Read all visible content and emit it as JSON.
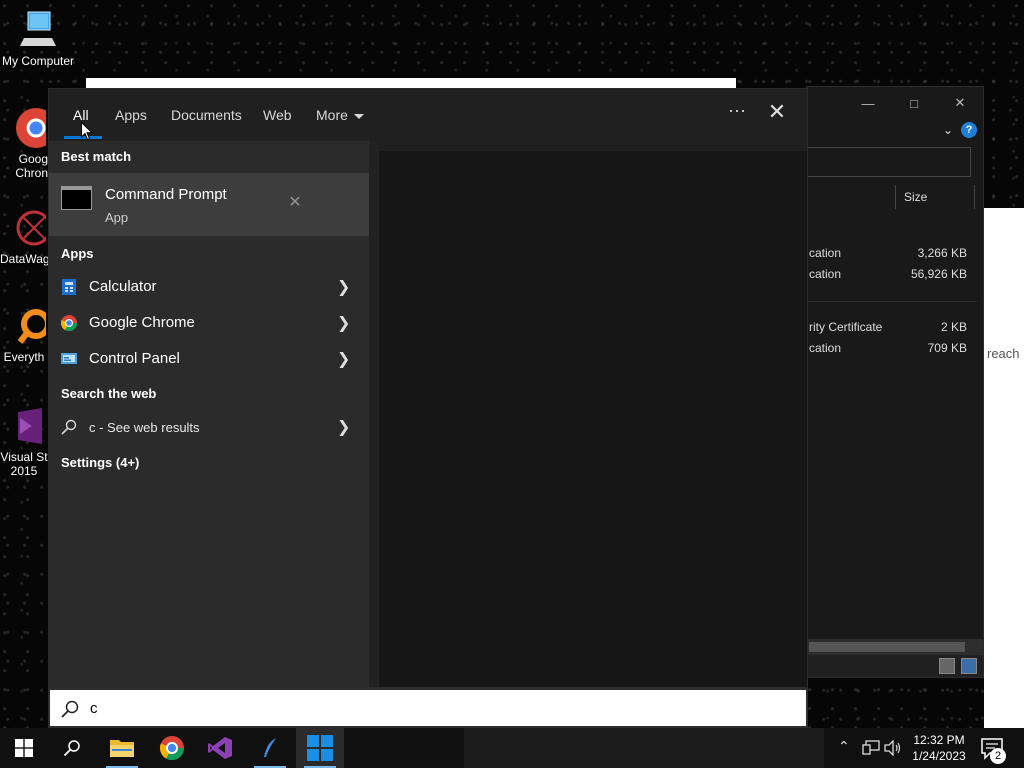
{
  "desktop": {
    "icons": [
      {
        "label": "My Computer"
      },
      {
        "label": "Goog Chron"
      },
      {
        "label": "DataWag"
      },
      {
        "label": "Everyth"
      },
      {
        "label": "Visual St 2015"
      }
    ]
  },
  "explorer": {
    "column_size": "Size",
    "rows": [
      {
        "type": "cation",
        "size": "3,266 KB"
      },
      {
        "type": "cation",
        "size": "56,926 KB"
      },
      {
        "type": "rity Certificate",
        "size": "2 KB"
      },
      {
        "type": "cation",
        "size": "709 KB"
      }
    ],
    "help": "?",
    "sliver_text": "reach"
  },
  "search_panel": {
    "tabs": [
      "All",
      "Apps",
      "Documents",
      "Web",
      "More"
    ],
    "best_match_header": "Best match",
    "best_match": {
      "title": "Command Prompt",
      "subtitle": "App"
    },
    "apps_header": "Apps",
    "apps": [
      {
        "name": "Calculator",
        "icon": "calculator-icon"
      },
      {
        "name": "Google Chrome",
        "icon": "chrome-icon"
      },
      {
        "name": "Control Panel",
        "icon": "control-panel-icon"
      }
    ],
    "web_header": "Search the web",
    "web_result": "c - See web results",
    "settings_header": "Settings (4+)",
    "query": "c"
  },
  "taskbar": {
    "time": "12:32 PM",
    "date": "1/24/2023",
    "notification_count": "2"
  },
  "colors": {
    "accent": "#0078d4",
    "panel": "#202020",
    "list": "#2b2b2b",
    "selected": "#3d3d3d"
  }
}
